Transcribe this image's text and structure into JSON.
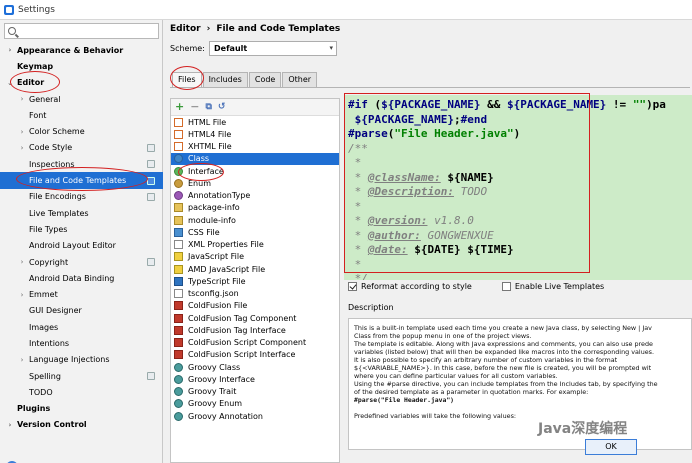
{
  "window": {
    "title": "Settings"
  },
  "search": {
    "placeholder": ""
  },
  "sidebar": {
    "items": [
      {
        "label": "Appearance & Behavior",
        "level": 0,
        "arrow": "›"
      },
      {
        "label": "Keymap",
        "level": 0,
        "arrow": ""
      },
      {
        "label": "Editor",
        "level": 0,
        "arrow": "⌄"
      },
      {
        "label": "General",
        "level": 1,
        "arrow": "›"
      },
      {
        "label": "Font",
        "level": 1,
        "arrow": ""
      },
      {
        "label": "Color Scheme",
        "level": 1,
        "arrow": "›"
      },
      {
        "label": "Code Style",
        "level": 1,
        "arrow": "›"
      },
      {
        "label": "Inspections",
        "level": 1,
        "arrow": ""
      },
      {
        "label": "File and Code Templates",
        "level": 1,
        "arrow": "",
        "selected": true
      },
      {
        "label": "File Encodings",
        "level": 1,
        "arrow": ""
      },
      {
        "label": "Live Templates",
        "level": 1,
        "arrow": ""
      },
      {
        "label": "File Types",
        "level": 1,
        "arrow": ""
      },
      {
        "label": "Android Layout Editor",
        "level": 1,
        "arrow": ""
      },
      {
        "label": "Copyright",
        "level": 1,
        "arrow": "›"
      },
      {
        "label": "Android Data Binding",
        "level": 1,
        "arrow": ""
      },
      {
        "label": "Emmet",
        "level": 1,
        "arrow": "›"
      },
      {
        "label": "GUI Designer",
        "level": 1,
        "arrow": ""
      },
      {
        "label": "Images",
        "level": 1,
        "arrow": ""
      },
      {
        "label": "Intentions",
        "level": 1,
        "arrow": ""
      },
      {
        "label": "Language Injections",
        "level": 1,
        "arrow": "›"
      },
      {
        "label": "Spelling",
        "level": 1,
        "arrow": ""
      },
      {
        "label": "TODO",
        "level": 1,
        "arrow": ""
      },
      {
        "label": "Plugins",
        "level": 0,
        "arrow": ""
      },
      {
        "label": "Version Control",
        "level": 0,
        "arrow": "›"
      }
    ]
  },
  "header": {
    "breadcrumb_parent": "Editor",
    "breadcrumb_sep": "›",
    "breadcrumb_current": "File and Code Templates"
  },
  "scheme": {
    "label": "Scheme:",
    "value": "Default"
  },
  "tabs": [
    {
      "label": "Files",
      "active": true
    },
    {
      "label": "Includes"
    },
    {
      "label": "Code"
    },
    {
      "label": "Other"
    }
  ],
  "toolbar": {
    "add": "+",
    "remove": "−",
    "copy": "⧉",
    "reset": "↺"
  },
  "templates": [
    {
      "label": "HTML File",
      "icon": "html"
    },
    {
      "label": "HTML4 File",
      "icon": "html"
    },
    {
      "label": "XHTML File",
      "icon": "html"
    },
    {
      "label": "Class",
      "icon": "class",
      "selected": true
    },
    {
      "label": "Interface",
      "icon": "iface"
    },
    {
      "label": "Enum",
      "icon": "enum"
    },
    {
      "label": "AnnotationType",
      "icon": "anno"
    },
    {
      "label": "package-info",
      "icon": "pkg"
    },
    {
      "label": "module-info",
      "icon": "pkg"
    },
    {
      "label": "CSS File",
      "icon": "css"
    },
    {
      "label": "XML Properties File",
      "icon": "file"
    },
    {
      "label": "JavaScript File",
      "icon": "js"
    },
    {
      "label": "AMD JavaScript File",
      "icon": "js"
    },
    {
      "label": "TypeScript File",
      "icon": "ts"
    },
    {
      "label": "tsconfig.json",
      "icon": "file"
    },
    {
      "label": "ColdFusion File",
      "icon": "cf"
    },
    {
      "label": "ColdFusion Tag Component",
      "icon": "cf"
    },
    {
      "label": "ColdFusion Tag Interface",
      "icon": "cf"
    },
    {
      "label": "ColdFusion Script Component",
      "icon": "cf"
    },
    {
      "label": "ColdFusion Script Interface",
      "icon": "cf"
    },
    {
      "label": "Groovy Class",
      "icon": "groovy"
    },
    {
      "label": "Groovy Interface",
      "icon": "groovy"
    },
    {
      "label": "Groovy Trait",
      "icon": "groovy"
    },
    {
      "label": "Groovy Enum",
      "icon": "groovy"
    },
    {
      "label": "Groovy Annotation",
      "icon": "groovy"
    }
  ],
  "editor": {
    "l1_kw": "#if",
    "l1_a": " (",
    "l1_v1": "${PACKAGE_NAME}",
    "l1_b": " && ",
    "l1_v2": "${PACKAGE_NAME}",
    "l1_c": " != ",
    "l1_s": "\"\"",
    "l1_d": ")pa",
    "l2_v": " ${PACKAGE_NAME}",
    "l2_a": ";",
    "l2_kw": "#end",
    "l3_kw": "#parse",
    "l3_a": "(",
    "l3_s": "\"File Header.java\"",
    "l3_b": ")",
    "l4": "/**",
    "l5": " *",
    "l6_star": " * ",
    "l6_tag": "@className:",
    "l6_sp": " ",
    "l6_v": "${NAME}",
    "l7_star": " * ",
    "l7_tag": "@Description:",
    "l7_t": " TODO",
    "l8": " *",
    "l9_star": " * ",
    "l9_tag": "@version:",
    "l9_t": " v1.8.0",
    "l10_star": " * ",
    "l10_tag": "@author:",
    "l10_t": " GONGWENXUE",
    "l11_star": " * ",
    "l11_tag": "@date:",
    "l11_sp": " ",
    "l11_v1": "${DATE}",
    "l11_sp2": " ",
    "l11_v2": "${TIME}",
    "l12": " *",
    "l13": " */"
  },
  "options": {
    "reformat": "Reformat according to style",
    "live": "Enable Live Templates"
  },
  "description": {
    "label": "Description",
    "lines": [
      "This is a built-in template used each time you create a new Java class, by selecting New | Jav",
      "Class from the popup menu in one of the project views.",
      "The template is editable. Along with Java expressions and comments, you can also use prede",
      "variables (listed below) that will then be expanded like macros into the corresponding values.",
      "It is also possible to specify an arbitrary number of custom variables in the format",
      "${<VARIABLE_NAME>}. In this case, before the new file is created, you will be prompted wit",
      "where you can define particular values for all custom variables.",
      "Using the #parse directive, you can include templates from the Includes tab, by specifying the",
      "of the desired template as a parameter in quotation marks. For example:",
      "#parse(\"File Header.java\")",
      "",
      "Predefined variables will take the following values:"
    ]
  },
  "buttons": {
    "ok": "OK"
  },
  "watermark": "Java深度编程",
  "help": "?"
}
